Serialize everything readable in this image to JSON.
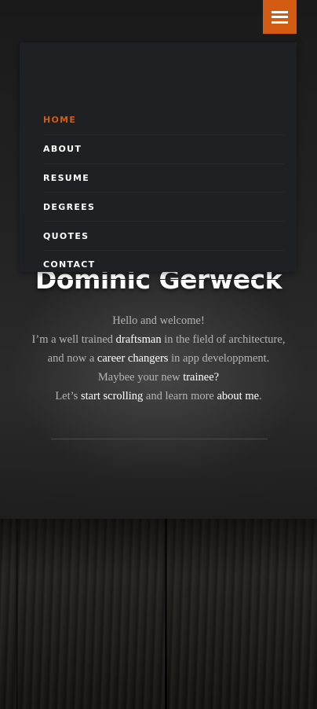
{
  "colors": {
    "accent": "#d35c12",
    "menu_bg": "#1f2023",
    "link_text": "#ffffff",
    "body_text": "#b4b4b4"
  },
  "nav": {
    "toggle_icon": "hamburger-icon",
    "items": [
      {
        "label": "HOME",
        "active": true
      },
      {
        "label": "ABOUT",
        "active": false
      },
      {
        "label": "RESUME",
        "active": false
      },
      {
        "label": "DEGREES",
        "active": false
      },
      {
        "label": "QUOTES",
        "active": false
      },
      {
        "label": "CONTACT",
        "active": false
      }
    ]
  },
  "hero": {
    "title": "Dominic Gerweck",
    "greeting": "Hello and welcome!",
    "line2_before": "I’m a well trained ",
    "line2_link": "draftsman",
    "line2_mid": " in the field of architecture, and now a ",
    "line2_link2": "career changers",
    "line2_after": " in app developpment.",
    "line3_before": "Maybee your new ",
    "line3_link": "trainee?",
    "line4_before": "Let’s ",
    "line4_link": "start scrolling",
    "line4_mid": " and learn more ",
    "line4_link2": "about me",
    "line4_after": "."
  }
}
